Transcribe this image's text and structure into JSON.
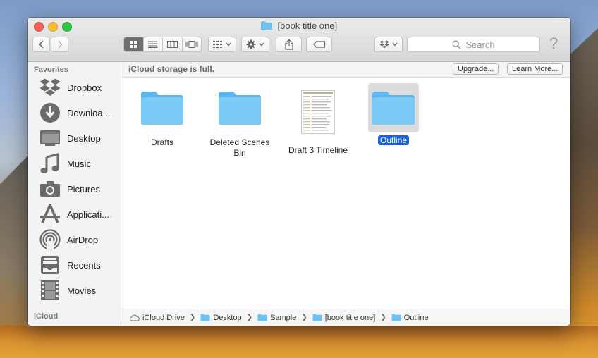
{
  "window": {
    "title": "[book title one]"
  },
  "toolbar": {
    "search_placeholder": "Search",
    "help_label": "?"
  },
  "sidebar": {
    "favorites_header": "Favorites",
    "icloud_header": "iCloud",
    "items": [
      {
        "label": "Dropbox",
        "icon": "dropbox-icon"
      },
      {
        "label": "Downloa...",
        "icon": "downloads-icon"
      },
      {
        "label": "Desktop",
        "icon": "desktop-icon"
      },
      {
        "label": "Music",
        "icon": "music-icon"
      },
      {
        "label": "Pictures",
        "icon": "camera-icon"
      },
      {
        "label": "Applicati...",
        "icon": "applications-icon"
      },
      {
        "label": "AirDrop",
        "icon": "airdrop-icon"
      },
      {
        "label": "Recents",
        "icon": "recents-icon"
      },
      {
        "label": "Movies",
        "icon": "film-icon"
      }
    ]
  },
  "banner": {
    "message": "iCloud storage is full.",
    "upgrade_label": "Upgrade...",
    "learn_more_label": "Learn More..."
  },
  "files": [
    {
      "name": "Drafts",
      "type": "folder"
    },
    {
      "name": "Deleted Scenes Bin",
      "type": "folder"
    },
    {
      "name": "Draft 3 Timeline",
      "type": "document"
    },
    {
      "name": "Outline",
      "type": "folder",
      "selected": true
    }
  ],
  "pathbar": {
    "crumbs": [
      "iCloud Drive",
      "Desktop",
      "Sample",
      "[book title one]",
      "Outline"
    ]
  },
  "colors": {
    "folder": "#5ab8f0",
    "selection": "#1b63d8"
  }
}
